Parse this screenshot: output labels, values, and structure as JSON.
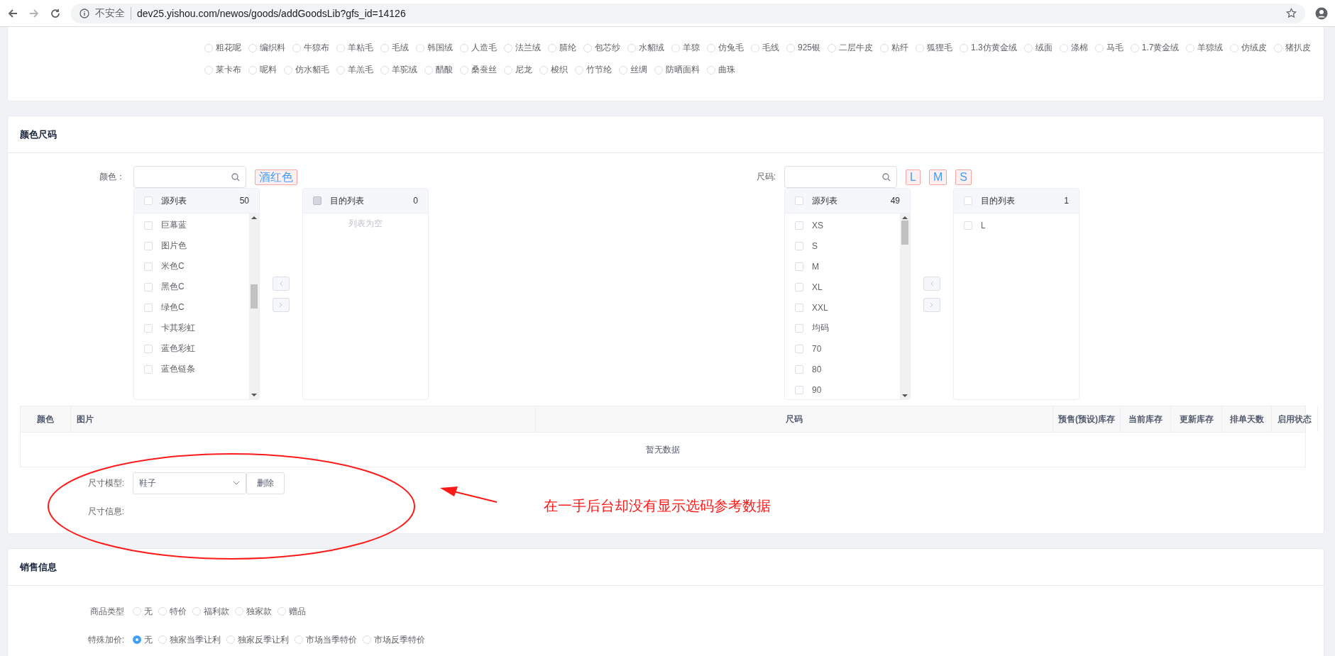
{
  "browser": {
    "security_label": "不安全",
    "url": "dev25.yishou.com/newos/goods/addGoodsLib?gfs_id=14126"
  },
  "fabric_rows": [
    [
      {
        "label": "粗花呢",
        "selected": false
      },
      {
        "label": "编织料",
        "selected": false
      },
      {
        "label": "牛猄布",
        "selected": false
      },
      {
        "label": "羊粘毛",
        "selected": false
      },
      {
        "label": "毛绒",
        "selected": false
      },
      {
        "label": "韩国绒",
        "selected": false
      },
      {
        "label": "人造毛",
        "selected": false
      },
      {
        "label": "法兰绒",
        "selected": false
      },
      {
        "label": "腈纶",
        "selected": false
      },
      {
        "label": "包芯纱",
        "selected": false
      },
      {
        "label": "水貂绒",
        "selected": false
      },
      {
        "label": "羊猄",
        "selected": false
      },
      {
        "label": "仿兔毛",
        "selected": false
      },
      {
        "label": "毛线",
        "selected": false
      },
      {
        "label": "925银",
        "selected": false
      },
      {
        "label": "二层牛皮",
        "selected": false
      },
      {
        "label": "粘纤",
        "selected": false
      },
      {
        "label": "狐狸毛",
        "selected": false
      },
      {
        "label": "1.3仿黄金绒",
        "selected": false
      },
      {
        "label": "绒面",
        "selected": false
      },
      {
        "label": "涤棉",
        "selected": false
      },
      {
        "label": "马毛",
        "selected": false
      },
      {
        "label": "1.7黄金绒",
        "selected": false
      },
      {
        "label": "羊猄绒",
        "selected": false
      },
      {
        "label": "仿绒皮",
        "selected": false
      },
      {
        "label": "猪扒皮",
        "selected": false
      }
    ],
    [
      {
        "label": "莱卡布",
        "selected": false
      },
      {
        "label": "呢料",
        "selected": false
      },
      {
        "label": "仿水貂毛",
        "selected": false
      },
      {
        "label": "羊羔毛",
        "selected": false
      },
      {
        "label": "羊驼绒",
        "selected": false
      },
      {
        "label": "醋酸",
        "selected": false
      },
      {
        "label": "桑蚕丝",
        "selected": false
      },
      {
        "label": "尼龙",
        "selected": false
      },
      {
        "label": "梭织",
        "selected": false
      },
      {
        "label": "竹节纶",
        "selected": false
      },
      {
        "label": "丝绸",
        "selected": false
      },
      {
        "label": "防晒面料",
        "selected": false
      },
      {
        "label": "曲珠",
        "selected": false
      }
    ]
  ],
  "color_size": {
    "title": "颜色尺码",
    "pickers": [
      {
        "label": "颜色：",
        "tags": [
          "酒红色"
        ],
        "source": {
          "title": "源列表",
          "count": "50",
          "checked": false,
          "disabled": false,
          "items": [
            {
              "label": "巨幕蓝",
              "checked": false
            },
            {
              "label": "图片色",
              "checked": false
            },
            {
              "label": "米色C",
              "checked": false
            },
            {
              "label": "黑色C",
              "checked": false
            },
            {
              "label": "绿色C",
              "checked": false
            },
            {
              "label": "卡其彩虹",
              "checked": false
            },
            {
              "label": "蓝色彩虹",
              "checked": false
            },
            {
              "label": "蓝色链条",
              "checked": false
            }
          ]
        },
        "target": {
          "title": "目的列表",
          "count": "0",
          "checked": false,
          "disabled": true,
          "empty_text": "列表为空"
        }
      },
      {
        "label": "尺码:",
        "tags": [
          "L",
          "M",
          "S"
        ],
        "source": {
          "title": "源列表",
          "count": "49",
          "checked": false,
          "disabled": false,
          "items": [
            {
              "label": "XS",
              "checked": false
            },
            {
              "label": "S",
              "checked": false
            },
            {
              "label": "M",
              "checked": false
            },
            {
              "label": "XL",
              "checked": false
            },
            {
              "label": "XXL",
              "checked": false
            },
            {
              "label": "均码",
              "checked": false
            },
            {
              "label": "70",
              "checked": false
            },
            {
              "label": "80",
              "checked": false
            },
            {
              "label": "90",
              "checked": false
            }
          ]
        },
        "target": {
          "title": "目的列表",
          "count": "1",
          "checked": false,
          "disabled": false,
          "items": [
            {
              "label": "L",
              "checked": false
            }
          ]
        }
      }
    ],
    "table": {
      "columns": [
        "颜色",
        "图片",
        "尺码",
        "预售(预设)库存",
        "当前库存",
        "更新库存",
        "排单天数",
        "启用状态"
      ],
      "empty_text": "暂无数据"
    },
    "size_model": {
      "label": "尺寸模型:",
      "value": "鞋子",
      "delete_button": "删除"
    },
    "size_info": {
      "label": "尺寸信息:"
    }
  },
  "annotation": {
    "text": "在一手后台却没有显示选码参考数据"
  },
  "sales": {
    "title": "销售信息",
    "rows": [
      {
        "label": "商品类型",
        "options": [
          {
            "label": "无",
            "selected": false
          },
          {
            "label": "特价",
            "selected": false
          },
          {
            "label": "福利款",
            "selected": false
          },
          {
            "label": "独家款",
            "selected": false
          },
          {
            "label": "赠品",
            "selected": false
          }
        ]
      },
      {
        "label": "特殊加价:",
        "options": [
          {
            "label": "无",
            "selected": true
          },
          {
            "label": "独家当季让利",
            "selected": false
          },
          {
            "label": "独家反季让利",
            "selected": false
          },
          {
            "label": "市场当季特价",
            "selected": false
          },
          {
            "label": "市场反季特价",
            "selected": false
          }
        ]
      }
    ]
  }
}
